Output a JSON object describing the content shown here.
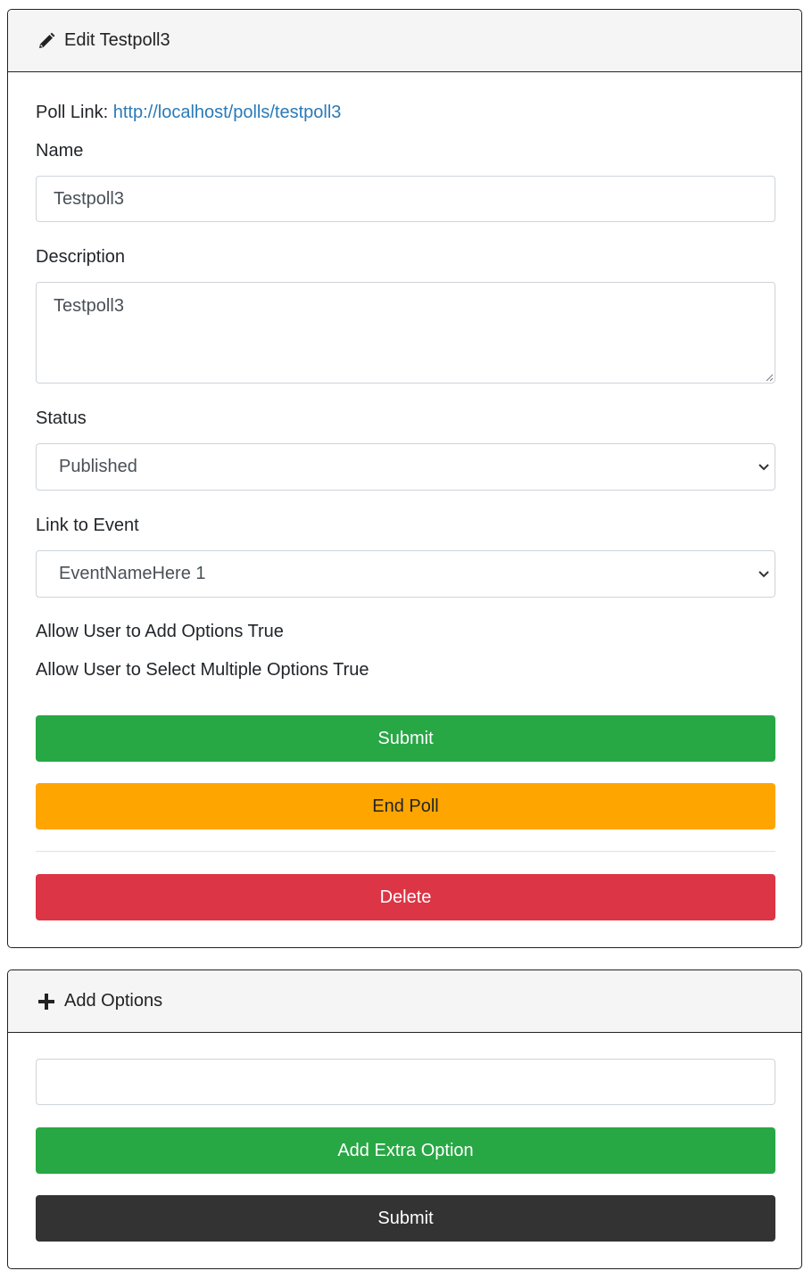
{
  "edit_card": {
    "title": "Edit Testpoll3",
    "header_icon": "pencil-icon",
    "poll_link_label": "Poll Link:",
    "poll_link_url": "http://localhost/polls/testpoll3",
    "name_label": "Name",
    "name_value": "Testpoll3",
    "description_label": "Description",
    "description_value": "Testpoll3",
    "status_label": "Status",
    "status_value": "Published",
    "event_label": "Link to Event",
    "event_value": "EventNameHere 1",
    "allow_add_options": "Allow User to Add Options True",
    "allow_multiple": "Allow User to Select Multiple Options True",
    "submit_label": "Submit",
    "end_poll_label": "End Poll",
    "delete_label": "Delete"
  },
  "options_card": {
    "title": "Add Options",
    "header_icon": "plus-icon",
    "option_value": "",
    "add_extra_label": "Add Extra Option",
    "submit_label": "Submit"
  },
  "colors": {
    "success": "#28a745",
    "warning": "#ffa500",
    "danger": "#dc3545",
    "dark": "#333333",
    "link": "#2a7ab8"
  }
}
